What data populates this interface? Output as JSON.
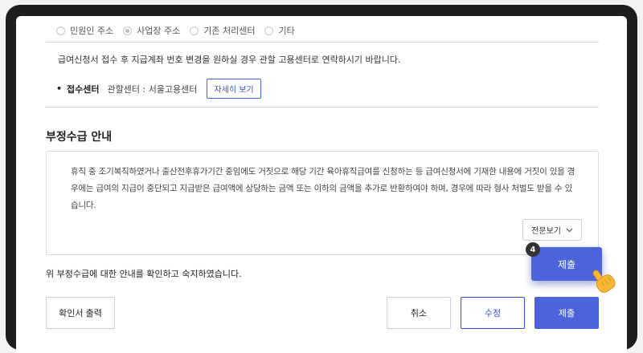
{
  "address_options": [
    {
      "label": "민원인 주소",
      "checked": false
    },
    {
      "label": "사업장 주소",
      "checked": true
    },
    {
      "label": "기존 처리센터",
      "checked": false
    },
    {
      "label": "기타",
      "checked": false
    }
  ],
  "notice": "급여신청서 접수 후 지급계좌 번호 변경을 원하실 경우 관할 고용센터로 연락하시기 바랍니다.",
  "reception": {
    "bullet": "•",
    "label": "접수센터",
    "value": "관할센터 : 서울고용센터",
    "detail_button": "자세히 보기"
  },
  "fraud_section": {
    "title": "부정수급 안내",
    "text": "휴직 중 조기복직하였거나 출산전후휴가기간 중임에도 거짓으로 해당 기간 육아휴직급여를 신청하는 등 급여신청서에 기재한 내용에 거짓이 있을 경우에는 급여의 지급이 중단되고 지급받은 급여액에 상당하는 금액 또는 이하의 금액을 추가로 반환하여야 하며, 경우에 따라 형사 처벌도 받을 수 있습니다.",
    "fulltext_button": "전문보기"
  },
  "confirm_text": "위 부정수급에 대한 안내를 확인하고 숙지하였습니다.",
  "buttons": {
    "print": "확인서 출력",
    "cancel": "취소",
    "edit": "수정",
    "submit": "제출"
  },
  "tutorial": {
    "step": "4",
    "highlight_label": "제출"
  },
  "colors": {
    "accent": "#4d63d9",
    "frame": "#1d1d1f"
  }
}
